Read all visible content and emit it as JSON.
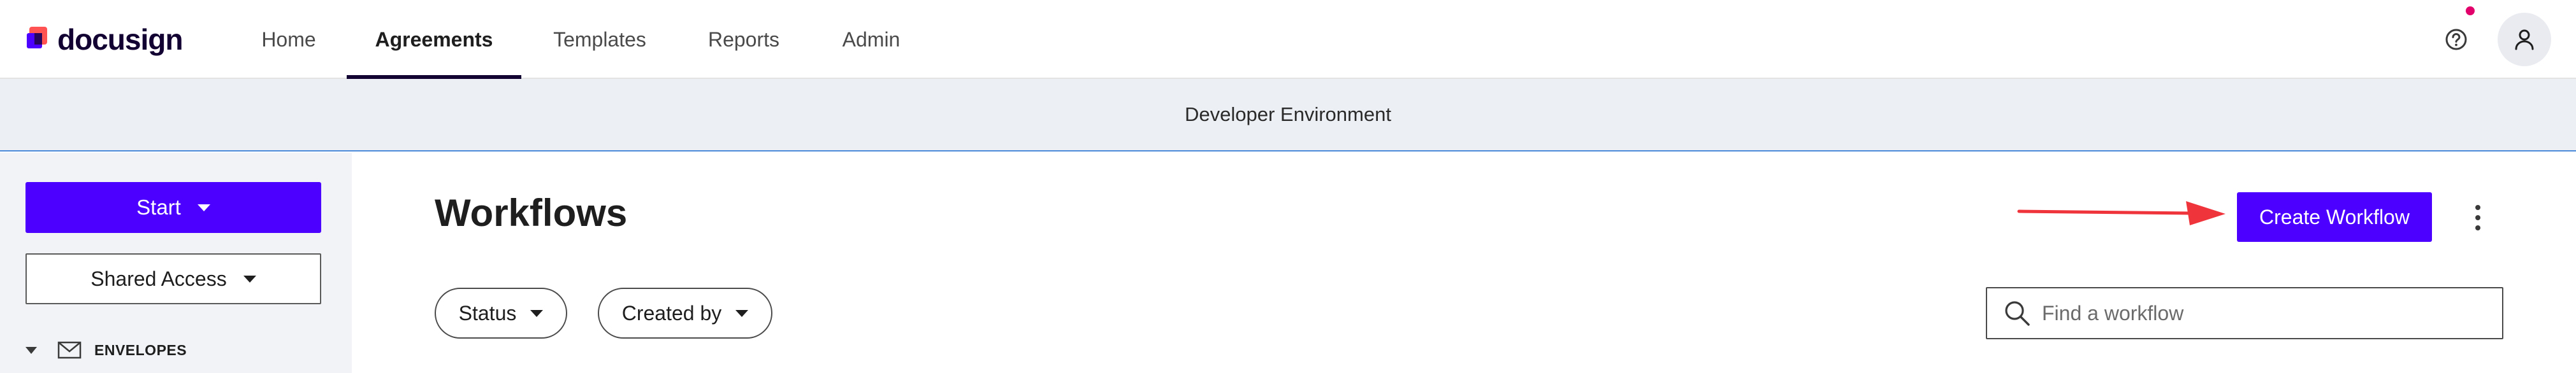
{
  "brand": {
    "name": "docusign"
  },
  "nav": {
    "items": [
      {
        "label": "Home"
      },
      {
        "label": "Agreements",
        "active": true
      },
      {
        "label": "Templates"
      },
      {
        "label": "Reports"
      },
      {
        "label": "Admin"
      }
    ],
    "icons": {
      "help": "help-icon",
      "profile": "user-icon"
    },
    "notification_color": "#e2006b"
  },
  "banner": {
    "text": "Developer Environment"
  },
  "sidebar": {
    "start_label": "Start",
    "shared_access_label": "Shared Access",
    "section_label": "ENVELOPES"
  },
  "main": {
    "title": "Workflows",
    "create_label": "Create Workflow",
    "filters": [
      {
        "label": "Status"
      },
      {
        "label": "Created by"
      }
    ],
    "search": {
      "placeholder": "Find a workflow",
      "value": ""
    }
  },
  "colors": {
    "accent": "#4c00ff",
    "annotation_arrow": "#f0343c",
    "banner_bg": "#eceff3",
    "sidebar_bg": "#f1f3f6"
  }
}
